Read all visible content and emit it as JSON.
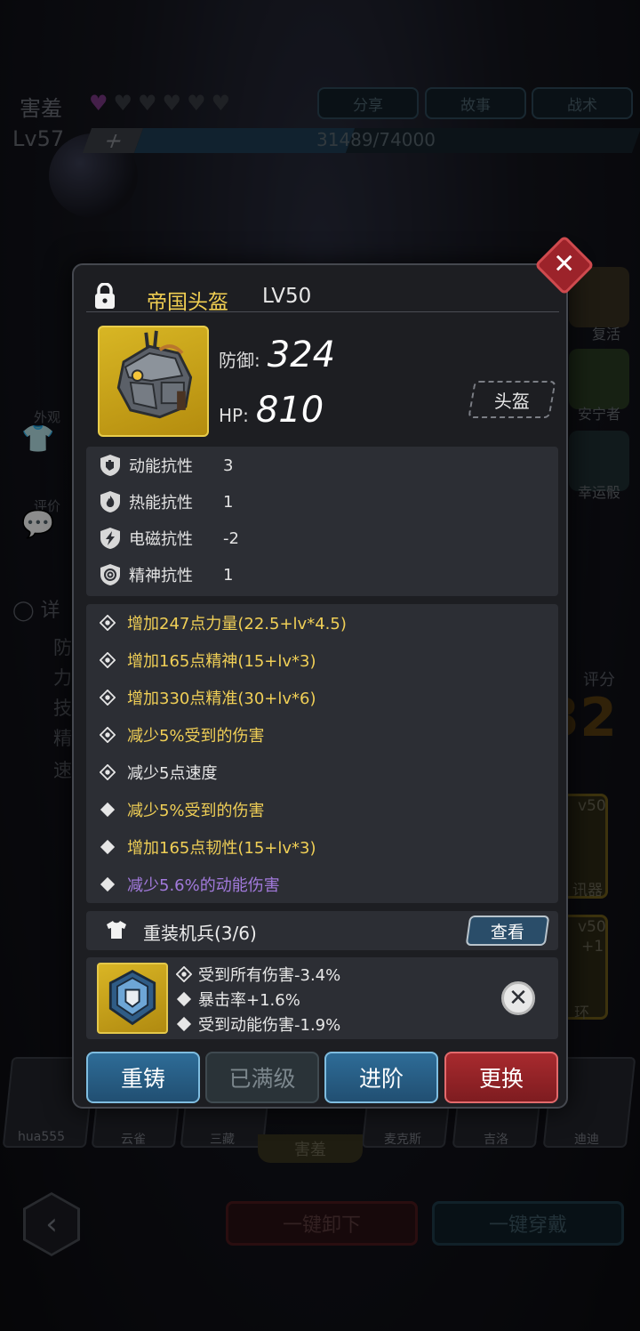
{
  "background": {
    "hero_name": "害羞",
    "hearts_total": 6,
    "hearts_filled": 1,
    "top_buttons": [
      "分享",
      "故事",
      "战术"
    ],
    "level": "Lv57",
    "xp_text": "31489/74000",
    "xp_fraction": 0.4255,
    "left_side": {
      "appearance": "外观",
      "review": "评价",
      "detail": "详",
      "attr_chars": [
        "防",
        "力",
        "技",
        "精",
        "速"
      ]
    },
    "right_side": {
      "revive": "复活",
      "guardian": "安宁者",
      "lucky_dice": "幸运骰",
      "score_label": "评分",
      "score_value": "32"
    },
    "item_cards": [
      "v50",
      "讯器",
      "v50",
      "+1",
      "环"
    ],
    "team": [
      "hua555",
      "云雀",
      "三藏",
      "麦克斯",
      "吉洛",
      "迪迪"
    ],
    "selected_member": "害羞",
    "unload_all": "一键卸下",
    "wear_all": "一键穿戴"
  },
  "modal": {
    "item_name": "帝国头盔",
    "item_level": "LV50",
    "stats": [
      {
        "label": "防御:",
        "value": "324"
      },
      {
        "label": "HP:",
        "value": "810"
      }
    ],
    "slot_type": "头盔",
    "resistances": [
      {
        "icon": "fist-shield-icon",
        "label": "动能抗性",
        "value": "3"
      },
      {
        "icon": "flame-shield-icon",
        "label": "热能抗性",
        "value": "1"
      },
      {
        "icon": "lightning-shield-icon",
        "label": "电磁抗性",
        "value": "-2"
      },
      {
        "icon": "spiral-shield-icon",
        "label": "精神抗性",
        "value": "1"
      }
    ],
    "attributes": [
      {
        "icon": "diamond-link-icon",
        "text": "增加247点力量(22.5+lv*4.5)",
        "color": "#f0cf56"
      },
      {
        "icon": "diamond-link-icon",
        "text": "增加165点精神(15+lv*3)",
        "color": "#f0cf56"
      },
      {
        "icon": "diamond-link-icon",
        "text": "增加330点精准(30+lv*6)",
        "color": "#f0cf56"
      },
      {
        "icon": "diamond-link-icon",
        "text": "减少5%受到的伤害",
        "color": "#f0cf56"
      },
      {
        "icon": "diamond-link-icon",
        "text": "减少5点速度",
        "color": "#e6e6e6"
      },
      {
        "icon": "diamond-icon",
        "text": "减少5%受到的伤害",
        "color": "#f0cf56"
      },
      {
        "icon": "diamond-icon",
        "text": "增加165点韧性(15+lv*3)",
        "color": "#f0cf56"
      },
      {
        "icon": "diamond-icon",
        "text": "减少5.6%的动能伤害",
        "color": "#a27adc"
      }
    ],
    "set": {
      "name": "重装机兵(3/6)",
      "view_label": "查看"
    },
    "gem_effects": [
      {
        "icon": "diamond-link-icon",
        "text": "受到所有伤害-3.4%"
      },
      {
        "icon": "diamond-icon",
        "text": "暴击率+1.6%"
      },
      {
        "icon": "diamond-icon",
        "text": "受到动能伤害-1.9%"
      }
    ],
    "actions": {
      "recast": "重铸",
      "max_level": "已满级",
      "advance": "进阶",
      "replace": "更换"
    }
  }
}
